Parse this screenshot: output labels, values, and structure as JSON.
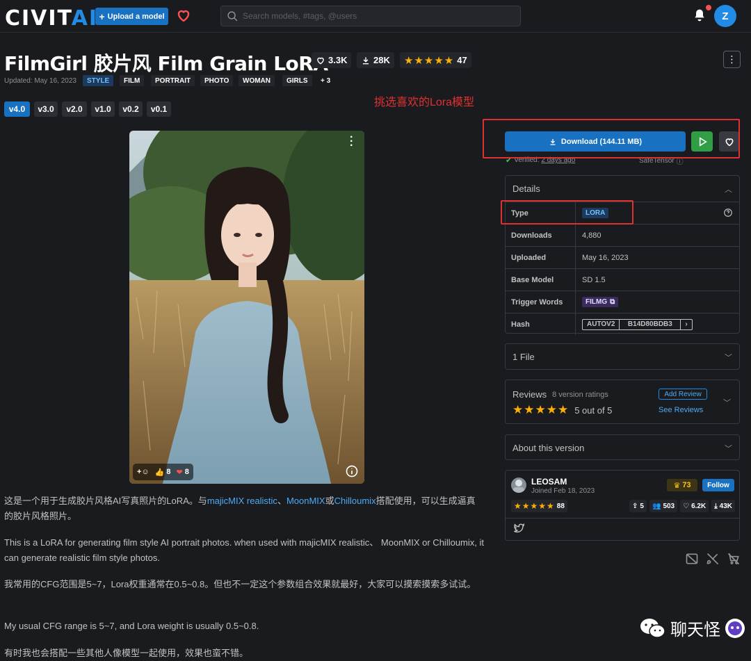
{
  "header": {
    "logo_main": "CIVIT",
    "logo_accent": "AI",
    "upload_label": "Upload a model",
    "search_placeholder": "Search models, #tags, @users",
    "avatar_letter": "Z"
  },
  "model": {
    "title": "FilmGirl 胶片风 Film Grain LoRA",
    "likes": "3.3K",
    "downloads": "28K",
    "rating_count": "47",
    "updated": "Updated: May 16, 2023",
    "tags": [
      "STYLE",
      "FILM",
      "PORTRAIT",
      "PHOTO",
      "WOMAN",
      "GIRLS",
      "+ 3"
    ],
    "versions": [
      "v4.0",
      "v3.0",
      "v2.0",
      "v1.0",
      "v0.2",
      "v0.1"
    ],
    "active_version": "v4.0"
  },
  "annotation": "挑选喜欢的Lora模型",
  "hero": {
    "reaction_like": "8",
    "reaction_heart": "8"
  },
  "description": {
    "p1_a": "这是一个用于生成胶片风格AI写真照片的LoRA。与",
    "p1_link1": "majicMIX realistic",
    "p1_sep1": "、",
    "p1_link2": "MoonMIX",
    "p1_sep2": "或",
    "p1_link3": "Chilloumix",
    "p1_b": "搭配使用，可以生成逼真的胶片风格照片。",
    "p2": "This is a LoRA for generating film style AI portrait photos. when used with majicMIX realistic、 MoonMIX or Chilloumix, it can generate realistic film style photos.",
    "p3": "我常用的CFG范围是5~7，Lora权重通常在0.5~0.8。但也不一定这个参数组合效果就最好，大家可以摸索摸索多试试。",
    "p4": "My usual CFG range is 5~7, and Lora weight is usually 0.5~0.8.",
    "p5": "有时我也会搭配一些其他人像模型一起使用，效果也蛮不错。"
  },
  "download": {
    "label": "Download (144.11 MB)",
    "verified_prefix": "Verified:",
    "verified_when": "2 days ago",
    "safetensor": "SafeTensor"
  },
  "details": {
    "header": "Details",
    "rows": {
      "type_k": "Type",
      "type_v": "LORA",
      "downloads_k": "Downloads",
      "downloads_v": "4,880",
      "uploaded_k": "Uploaded",
      "uploaded_v": "May 16, 2023",
      "base_k": "Base Model",
      "base_v": "SD 1.5",
      "trigger_k": "Trigger Words",
      "trigger_v": "FILMG",
      "hash_k": "Hash",
      "hash_type": "AUTOV2",
      "hash_v": "B14D80BDB3"
    }
  },
  "files": {
    "header": "1 File"
  },
  "reviews": {
    "title": "Reviews",
    "ratings": "8 version ratings",
    "score": "5 out of 5",
    "add": "Add Review",
    "see": "See Reviews"
  },
  "about": {
    "header": "About this version"
  },
  "creator": {
    "name": "LEOSAM",
    "joined": "Joined Feb 18, 2023",
    "rank": "73",
    "follow": "Follow",
    "rating_count": "88",
    "uploads": "5",
    "followers": "503",
    "likes": "6.2K",
    "downloads": "43K"
  },
  "watermark": "聊天怪",
  "colors": {
    "accent": "#1971c2",
    "run": "#2f9e44",
    "annotation": "#e03131",
    "star": "#fab005"
  }
}
